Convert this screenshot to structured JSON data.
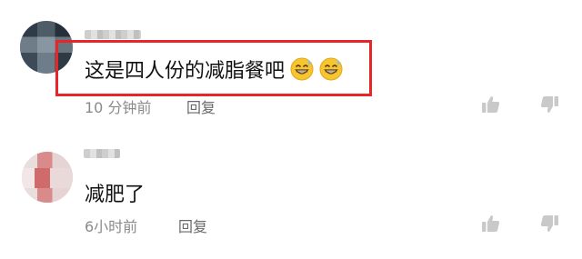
{
  "comments": [
    {
      "text": "这是四人份的减脂餐吧",
      "emojis": [
        "grinning-sweat-emoji",
        "grinning-sweat-emoji"
      ],
      "time": "10 分钟前",
      "reply_label": "回复",
      "highlighted": true,
      "highlight_color": "#e8262a"
    },
    {
      "text": "减肥了",
      "time": "6小时前",
      "reply_label": "回复",
      "highlighted": false
    }
  ],
  "icons": [
    "thumbs-up-icon",
    "thumbs-down-icon"
  ]
}
